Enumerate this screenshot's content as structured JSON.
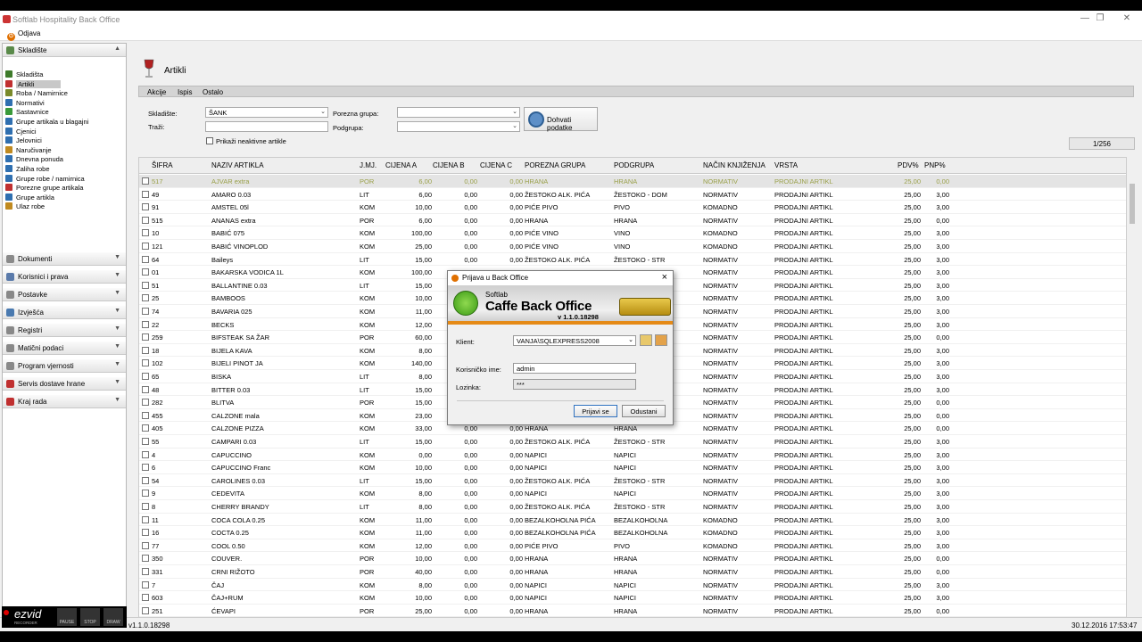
{
  "window": {
    "title": "Softlab Hospitality Back Office"
  },
  "menubar": {
    "logout": "Odjava"
  },
  "sidebar": {
    "section_open": "Skladište",
    "items": [
      {
        "label": "Skladišta",
        "color": "#3d7a2a"
      },
      {
        "label": "Artikli",
        "color": "#c03030"
      },
      {
        "label": "Roba / Namirnice",
        "color": "#7a8a2a"
      },
      {
        "label": "Normativi",
        "color": "#2f6fb0"
      },
      {
        "label": "Sastavnice",
        "color": "#3a9a3a"
      },
      {
        "label": "Grupe artikala u blagajni",
        "color": "#2f6fb0"
      },
      {
        "label": "Cjenici",
        "color": "#2f6fb0"
      },
      {
        "label": "Jelovnici",
        "color": "#2f6fb0"
      },
      {
        "label": "Naručivanje",
        "color": "#c08a20"
      },
      {
        "label": "Dnevna ponuda",
        "color": "#2f6fb0"
      },
      {
        "label": "Zaliha robe",
        "color": "#2f6fb0"
      },
      {
        "label": "Grupe robe / namirnica",
        "color": "#2f6fb0"
      },
      {
        "label": "Porezne grupe artikala",
        "color": "#c03030"
      },
      {
        "label": "Grupe artikla",
        "color": "#2f6fb0"
      },
      {
        "label": "Ulaz robe",
        "color": "#c08a20"
      }
    ],
    "sections": [
      {
        "label": "Dokumenti",
        "color": "#8a8a8a"
      },
      {
        "label": "Korisnici i prava",
        "color": "#5a7aaa"
      },
      {
        "label": "Postavke",
        "color": "#888"
      },
      {
        "label": "Izvješća",
        "color": "#4a7ab0"
      },
      {
        "label": "Registri",
        "color": "#888"
      },
      {
        "label": "Matični podaci",
        "color": "#888"
      },
      {
        "label": "Program vjernosti",
        "color": "#888"
      },
      {
        "label": "Servis dostave hrane",
        "color": "#c03030"
      },
      {
        "label": "Kraj rada",
        "color": "#c03030"
      }
    ]
  },
  "page": {
    "title": "Artikli"
  },
  "toolbar": {
    "akcije": "Akcije",
    "ispis": "Ispis",
    "ostalo": "Ostalo"
  },
  "filters": {
    "skladiste_label": "Skladište:",
    "skladiste_value": "ŠANK",
    "trazi_label": "Traži:",
    "porezna_label": "Porezna grupa:",
    "podgrupa_label": "Podgrupa:",
    "show_inactive": "Prikaži neaktivne artikle",
    "fetch_button": "Dohvati podatke",
    "pager": "1/256"
  },
  "grid": {
    "headers": [
      "ŠIFRA",
      "NAZIV ARTIKLA",
      "J.MJ.",
      "CIJENA A",
      "CIJENA B",
      "CIJENA C",
      "POREZNA GRUPA",
      "PODGRUPA",
      "NAČIN KNJIŽENJA",
      "VRSTA",
      "PDV%",
      "PNP%"
    ],
    "rows": [
      [
        "517",
        "AJVAR extra",
        "POR",
        "6,00",
        "0,00",
        "0,00",
        "HRANA",
        "HRANA",
        "NORMATIV",
        "PRODAJNI ARTIKL",
        "25,00",
        "0,00"
      ],
      [
        "49",
        "AMARO 0.03",
        "LIT",
        "6,00",
        "0,00",
        "0,00",
        "ŽESTOKO ALK. PIĆA",
        "ŽESTOKO - DOM",
        "NORMATIV",
        "PRODAJNI ARTIKL",
        "25,00",
        "3,00"
      ],
      [
        "91",
        "AMSTEL 05l",
        "KOM",
        "10,00",
        "0,00",
        "0,00",
        "PIĆE PIVO",
        "PIVO",
        "KOMADNO",
        "PRODAJNI ARTIKL",
        "25,00",
        "3,00"
      ],
      [
        "515",
        "ANANAS extra",
        "POR",
        "6,00",
        "0,00",
        "0,00",
        "HRANA",
        "HRANA",
        "NORMATIV",
        "PRODAJNI ARTIKL",
        "25,00",
        "0,00"
      ],
      [
        "10",
        "BABIĆ 075",
        "KOM",
        "100,00",
        "0,00",
        "0,00",
        "PIĆE VINO",
        "VINO",
        "KOMADNO",
        "PRODAJNI ARTIKL",
        "25,00",
        "3,00"
      ],
      [
        "121",
        "BABIĆ VINOPLOD",
        "KOM",
        "25,00",
        "0,00",
        "0,00",
        "PIĆE VINO",
        "VINO",
        "KOMADNO",
        "PRODAJNI ARTIKL",
        "25,00",
        "3,00"
      ],
      [
        "64",
        "Baileys",
        "LIT",
        "15,00",
        "0,00",
        "0,00",
        "ŽESTOKO ALK. PIĆA",
        "ŽESTOKO - STR",
        "NORMATIV",
        "PRODAJNI ARTIKL",
        "25,00",
        "3,00"
      ],
      [
        "01",
        "BAKARSKA VODICA 1L",
        "KOM",
        "100,00",
        "",
        "",
        "",
        "",
        "NORMATIV",
        "PRODAJNI ARTIKL",
        "25,00",
        "3,00"
      ],
      [
        "51",
        "BALLANTINE 0.03",
        "LIT",
        "15,00",
        "",
        "",
        "",
        "",
        "NORMATIV",
        "PRODAJNI ARTIKL",
        "25,00",
        "3,00"
      ],
      [
        "25",
        "BAMBOOS",
        "KOM",
        "10,00",
        "",
        "",
        "",
        "",
        "NORMATIV",
        "PRODAJNI ARTIKL",
        "25,00",
        "3,00"
      ],
      [
        "74",
        "BAVARIA 025",
        "KOM",
        "11,00",
        "",
        "",
        "",
        "",
        "NORMATIV",
        "PRODAJNI ARTIKL",
        "25,00",
        "3,00"
      ],
      [
        "22",
        "BECKS",
        "KOM",
        "12,00",
        "",
        "",
        "",
        "",
        "NORMATIV",
        "PRODAJNI ARTIKL",
        "25,00",
        "3,00"
      ],
      [
        "259",
        "BIFSTEAK SA ŽAR",
        "POR",
        "60,00",
        "",
        "",
        "",
        "",
        "NORMATIV",
        "PRODAJNI ARTIKL",
        "25,00",
        "0,00"
      ],
      [
        "18",
        "BIJELA KAVA",
        "KOM",
        "8,00",
        "",
        "",
        "",
        "",
        "NORMATIV",
        "PRODAJNI ARTIKL",
        "25,00",
        "3,00"
      ],
      [
        "102",
        "BIJELI PINOT JA",
        "KOM",
        "140,00",
        "",
        "",
        "",
        "",
        "NORMATIV",
        "PRODAJNI ARTIKL",
        "25,00",
        "3,00"
      ],
      [
        "65",
        "BISKA",
        "LIT",
        "8,00",
        "",
        "",
        "",
        "",
        "NORMATIV",
        "PRODAJNI ARTIKL",
        "25,00",
        "3,00"
      ],
      [
        "48",
        "BITTER 0.03",
        "LIT",
        "15,00",
        "",
        "",
        "",
        "",
        "NORMATIV",
        "PRODAJNI ARTIKL",
        "25,00",
        "3,00"
      ],
      [
        "282",
        "BLITVA",
        "POR",
        "15,00",
        "",
        "",
        "",
        "",
        "NORMATIV",
        "PRODAJNI ARTIKL",
        "25,00",
        "0,00"
      ],
      [
        "455",
        "CALZONE mala",
        "KOM",
        "23,00",
        "",
        "",
        "",
        "",
        "NORMATIV",
        "PRODAJNI ARTIKL",
        "25,00",
        "0,00"
      ],
      [
        "405",
        "CALZONE PIZZA",
        "KOM",
        "33,00",
        "0,00",
        "0,00",
        "HRANA",
        "HRANA",
        "NORMATIV",
        "PRODAJNI ARTIKL",
        "25,00",
        "0,00"
      ],
      [
        "55",
        "CAMPARI 0.03",
        "LIT",
        "15,00",
        "0,00",
        "0,00",
        "ŽESTOKO ALK. PIĆA",
        "ŽESTOKO - STR",
        "NORMATIV",
        "PRODAJNI ARTIKL",
        "25,00",
        "3,00"
      ],
      [
        "4",
        "CAPUCCINO",
        "KOM",
        "0,00",
        "0,00",
        "0,00",
        "NAPICI",
        "NAPICI",
        "NORMATIV",
        "PRODAJNI ARTIKL",
        "25,00",
        "3,00"
      ],
      [
        "6",
        "CAPUCCINO Franc",
        "KOM",
        "10,00",
        "0,00",
        "0,00",
        "NAPICI",
        "NAPICI",
        "NORMATIV",
        "PRODAJNI ARTIKL",
        "25,00",
        "3,00"
      ],
      [
        "54",
        "CAROLINES 0.03",
        "LIT",
        "15,00",
        "0,00",
        "0,00",
        "ŽESTOKO ALK. PIĆA",
        "ŽESTOKO - STR",
        "NORMATIV",
        "PRODAJNI ARTIKL",
        "25,00",
        "3,00"
      ],
      [
        "9",
        "CEDEVITA",
        "KOM",
        "8,00",
        "0,00",
        "0,00",
        "NAPICI",
        "NAPICI",
        "NORMATIV",
        "PRODAJNI ARTIKL",
        "25,00",
        "3,00"
      ],
      [
        "8",
        "CHERRY BRANDY",
        "LIT",
        "8,00",
        "0,00",
        "0,00",
        "ŽESTOKO ALK. PIĆA",
        "ŽESTOKO - STR",
        "NORMATIV",
        "PRODAJNI ARTIKL",
        "25,00",
        "3,00"
      ],
      [
        "11",
        "COCA COLA 0.25",
        "KOM",
        "11,00",
        "0,00",
        "0,00",
        "BEZALKOHOLNA PIĆA",
        "BEZALKOHOLNA",
        "KOMADNO",
        "PRODAJNI ARTIKL",
        "25,00",
        "3,00"
      ],
      [
        "16",
        "COCTA 0.25",
        "KOM",
        "11,00",
        "0,00",
        "0,00",
        "BEZALKOHOLNA PIĆA",
        "BEZALKOHOLNA",
        "KOMADNO",
        "PRODAJNI ARTIKL",
        "25,00",
        "3,00"
      ],
      [
        "77",
        "COOL 0.50",
        "KOM",
        "12,00",
        "0,00",
        "0,00",
        "PIĆE PIVO",
        "PIVO",
        "KOMADNO",
        "PRODAJNI ARTIKL",
        "25,00",
        "3,00"
      ],
      [
        "350",
        "COUVER.",
        "POR",
        "10,00",
        "0,00",
        "0,00",
        "HRANA",
        "HRANA",
        "NORMATIV",
        "PRODAJNI ARTIKL",
        "25,00",
        "0,00"
      ],
      [
        "331",
        "CRNI RIŽOTO",
        "POR",
        "40,00",
        "0,00",
        "0,00",
        "HRANA",
        "HRANA",
        "NORMATIV",
        "PRODAJNI ARTIKL",
        "25,00",
        "0,00"
      ],
      [
        "7",
        "ČAJ",
        "KOM",
        "8,00",
        "0,00",
        "0,00",
        "NAPICI",
        "NAPICI",
        "NORMATIV",
        "PRODAJNI ARTIKL",
        "25,00",
        "3,00"
      ],
      [
        "603",
        "ČAJ+RUM",
        "KOM",
        "10,00",
        "0,00",
        "0,00",
        "NAPICI",
        "NAPICI",
        "NORMATIV",
        "PRODAJNI ARTIKL",
        "25,00",
        "3,00"
      ],
      [
        "251",
        "ĆEVAPI",
        "POR",
        "25,00",
        "0,00",
        "0,00",
        "HRANA",
        "HRANA",
        "NORMATIV",
        "PRODAJNI ARTIKL",
        "25,00",
        "0,00"
      ]
    ]
  },
  "dialog": {
    "title": "Prijava u Back Office",
    "brand_small": "Softlab",
    "brand_big": "Caffe Back Office",
    "version": "v 1.1.0.18298",
    "klient_label": "Klient:",
    "klient_value": "VANJA\\SQLEXPRESS2008",
    "user_label": "Korisničko ime:",
    "user_value": "admin",
    "pass_label": "Lozinka:",
    "pass_value": "***",
    "login_button": "Prijavi se",
    "cancel_button": "Odustani"
  },
  "status": {
    "version": "v1.1.0.18298",
    "datetime": "30.12.2016 17:53:47"
  },
  "recorder": {
    "brand": "ezvid",
    "sub": "RECORDER",
    "pause": "PAUSE",
    "stop": "STOP",
    "draw": "DRAW"
  }
}
